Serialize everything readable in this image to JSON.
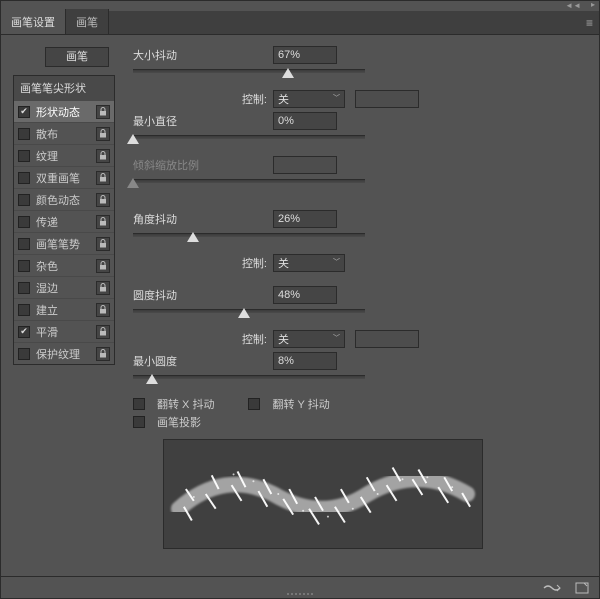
{
  "tabs": {
    "settings": "画笔设置",
    "brushes": "画笔"
  },
  "left_button": "画笔",
  "attr_header": "画笔笔尖形状",
  "attrs": [
    {
      "label": "形状动态",
      "checked": true,
      "selected": true
    },
    {
      "label": "散布",
      "checked": false,
      "selected": false
    },
    {
      "label": "纹理",
      "checked": false,
      "selected": false
    },
    {
      "label": "双重画笔",
      "checked": false,
      "selected": false
    },
    {
      "label": "颜色动态",
      "checked": false,
      "selected": false
    },
    {
      "label": "传递",
      "checked": false,
      "selected": false
    },
    {
      "label": "画笔笔势",
      "checked": false,
      "selected": false
    },
    {
      "label": "杂色",
      "checked": false,
      "selected": false
    },
    {
      "label": "湿边",
      "checked": false,
      "selected": false
    },
    {
      "label": "建立",
      "checked": false,
      "selected": false
    },
    {
      "label": "平滑",
      "checked": true,
      "selected": false
    },
    {
      "label": "保护纹理",
      "checked": false,
      "selected": false
    }
  ],
  "labels": {
    "size_jitter": "大小抖动",
    "control": "控制:",
    "off": "关",
    "min_diameter": "最小直径",
    "tilt_scale": "倾斜缩放比例",
    "angle_jitter": "角度抖动",
    "round_jitter": "圆度抖动",
    "min_round": "最小圆度",
    "flip_x": "翻转 X 抖动",
    "flip_y": "翻转 Y 抖动",
    "brush_proj": "画笔投影"
  },
  "values": {
    "size_jitter": "67%",
    "min_diameter": "0%",
    "tilt_scale": "",
    "angle_jitter": "26%",
    "round_jitter": "48%",
    "min_round": "8%"
  },
  "checks": {
    "flip_x": false,
    "flip_y": false,
    "brush_proj": false
  },
  "sliders": {
    "size_jitter_pct": 67,
    "min_diameter_pct": 0,
    "tilt_scale_pct": 0,
    "angle_jitter_pct": 26,
    "round_jitter_pct": 48,
    "min_round_pct": 8
  }
}
